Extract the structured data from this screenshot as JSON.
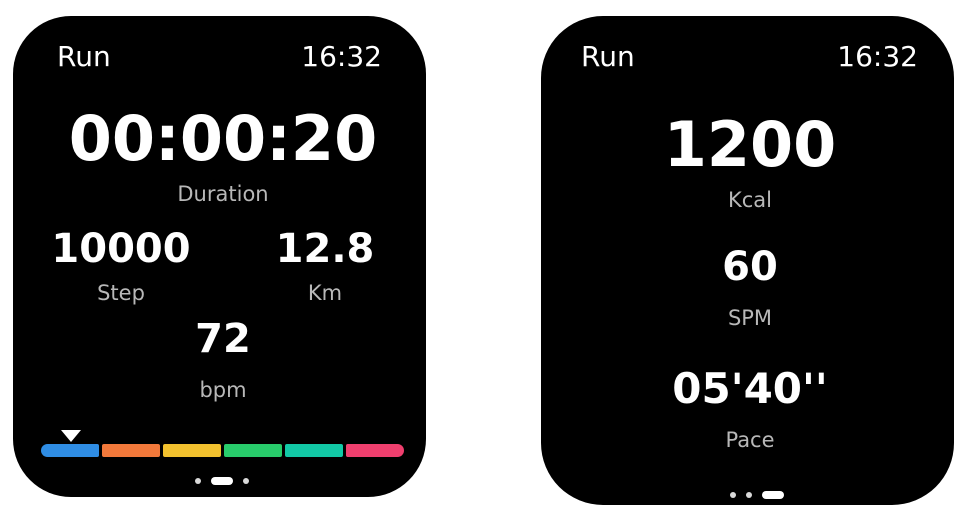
{
  "watch_left": {
    "app_title": "Run",
    "clock": "16:32",
    "duration_value": "00:00:20",
    "duration_label": "Duration",
    "steps_value": "10000",
    "steps_label": "Step",
    "distance_value": "12.8",
    "distance_label": "Km",
    "heart_rate_value": "72",
    "heart_rate_label": "bpm",
    "hr_zone_colors": [
      "#2f8de4",
      "#f2793b",
      "#f2c12e",
      "#28cc6b",
      "#12c9a6",
      "#ef3f6e"
    ],
    "hr_zone_active_index": 0,
    "page_indicator": {
      "count": 3,
      "active_index": 1
    }
  },
  "watch_right": {
    "app_title": "Run",
    "clock": "16:32",
    "calories_value": "1200",
    "calories_label": "Kcal",
    "cadence_value": "60",
    "cadence_label": "SPM",
    "pace_value": "05'40''",
    "pace_label": "Pace",
    "page_indicator": {
      "count": 3,
      "active_index": 2
    }
  }
}
